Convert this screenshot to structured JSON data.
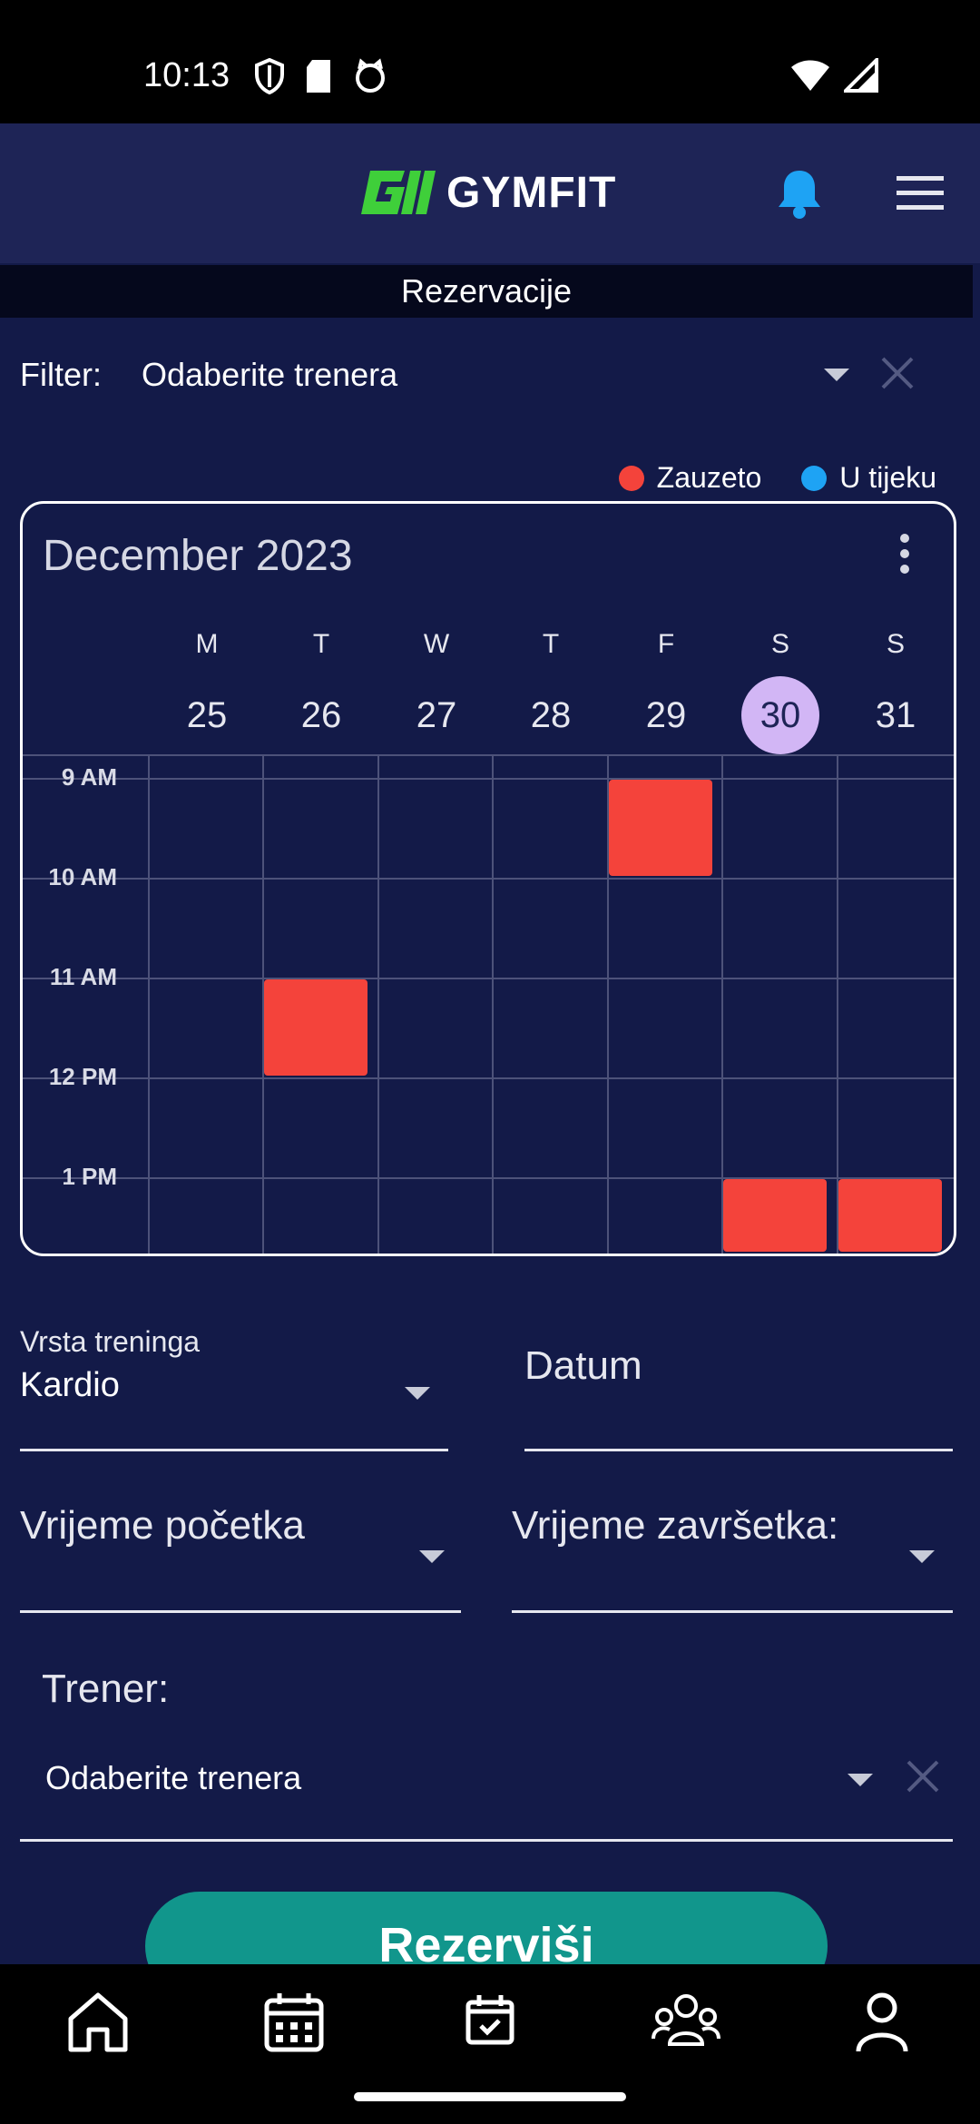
{
  "status_bar": {
    "time": "10:13"
  },
  "header": {
    "logo_gym": "GYM",
    "logo_fit": "FIT"
  },
  "page_title": "Rezervacije",
  "filter": {
    "label": "Filter:",
    "value": "Odaberite trenera"
  },
  "legend": [
    {
      "label": "Zauzeto",
      "color": "#f4433b"
    },
    {
      "label": "U tijeku",
      "color": "#1ea3f4"
    }
  ],
  "calendar": {
    "title": "December 2023",
    "weekdays": [
      "M",
      "T",
      "W",
      "T",
      "F",
      "S",
      "S"
    ],
    "days": [
      "25",
      "26",
      "27",
      "28",
      "29",
      "30",
      "31"
    ],
    "selected_day": "30",
    "time_labels": [
      "9 AM",
      "10 AM",
      "11 AM",
      "12 PM",
      "1 PM"
    ],
    "events": [
      {
        "day": "29",
        "start": "9 AM",
        "end": "10 AM",
        "status": "Zauzeto"
      },
      {
        "day": "26",
        "start": "11 AM",
        "end": "12 PM",
        "status": "Zauzeto"
      },
      {
        "day": "30",
        "start": "1 PM",
        "end": "2 PM",
        "status": "Zauzeto"
      },
      {
        "day": "31",
        "start": "1 PM",
        "end": "2 PM",
        "status": "Zauzeto"
      }
    ]
  },
  "form": {
    "training_type_label": "Vrsta treninga",
    "training_type_value": "Kardio",
    "date_label": "Datum",
    "start_time_label": "Vrijeme početka",
    "end_time_label": "Vrijeme završetka:",
    "trainer_label": "Trener:",
    "trainer_value": "Odaberite trenera",
    "submit_label": "Rezerviši"
  },
  "bottom_nav": [
    "home-icon",
    "calendar-icon",
    "calendar-check-icon",
    "group-icon",
    "profile-icon"
  ]
}
